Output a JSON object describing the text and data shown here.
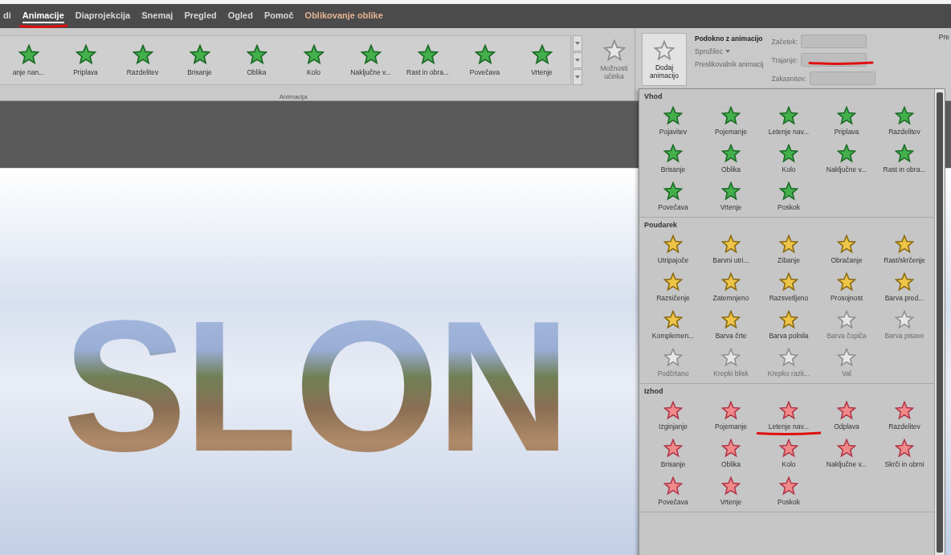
{
  "menu": [
    {
      "label": "di",
      "selected": false,
      "kind": "normal",
      "marked": false
    },
    {
      "label": "Animacije",
      "selected": true,
      "kind": "normal",
      "marked": true
    },
    {
      "label": "Diaprojekcija",
      "selected": false,
      "kind": "normal",
      "marked": false
    },
    {
      "label": "Snemaj",
      "selected": false,
      "kind": "normal",
      "marked": false
    },
    {
      "label": "Pregled",
      "selected": false,
      "kind": "normal",
      "marked": false
    },
    {
      "label": "Ogled",
      "selected": false,
      "kind": "normal",
      "marked": false
    },
    {
      "label": "Pomoč",
      "selected": false,
      "kind": "normal",
      "marked": false
    },
    {
      "label": "Oblikovanje oblike",
      "selected": false,
      "kind": "contextual",
      "marked": false
    }
  ],
  "ribbon": {
    "gallery": {
      "group_label": "Animacija",
      "items": [
        {
          "label": "anje nan..."
        },
        {
          "label": "Priplava"
        },
        {
          "label": "Razdelitev"
        },
        {
          "label": "Brisanje"
        },
        {
          "label": "Oblika"
        },
        {
          "label": "Kolo"
        },
        {
          "label": "Naključne v..."
        },
        {
          "label": "Rast in obra..."
        },
        {
          "label": "Povečava"
        },
        {
          "label": "Vrtenje"
        }
      ]
    },
    "effect_options": {
      "label": "Možnosti učinka",
      "disabled": true
    },
    "add_animation": {
      "label": "Dodaj animacijo"
    },
    "advanced": [
      {
        "label": "Podokno z animacijo",
        "disabled": false
      },
      {
        "label": "Sprožilec",
        "disabled": true
      },
      {
        "label": "Preslikovalnik animacij",
        "disabled": true
      }
    ],
    "timing": [
      {
        "label": "Začetek:",
        "disabled": true,
        "marked": false
      },
      {
        "label": "Trajanje:",
        "disabled": true,
        "marked": true
      },
      {
        "label": "Zakasnitev:",
        "disabled": true,
        "marked": false
      }
    ],
    "next_group_label": "Pre"
  },
  "slide": {
    "title": "SLON"
  },
  "panel": {
    "sections": [
      {
        "title": "Vhod",
        "kind": "entrance",
        "items": [
          {
            "label": "Pojavitev",
            "disabled": false,
            "marked": false
          },
          {
            "label": "Pojemanje",
            "disabled": false,
            "marked": false
          },
          {
            "label": "Letenje nav...",
            "disabled": false,
            "marked": false
          },
          {
            "label": "Priplava",
            "disabled": false,
            "marked": false
          },
          {
            "label": "Razdelitev",
            "disabled": false,
            "marked": false
          },
          {
            "label": "Brisanje",
            "disabled": false,
            "marked": false
          },
          {
            "label": "Oblika",
            "disabled": false,
            "marked": false
          },
          {
            "label": "Kolo",
            "disabled": false,
            "marked": false
          },
          {
            "label": "Naključne v...",
            "disabled": false,
            "marked": false
          },
          {
            "label": "Rast in obra...",
            "disabled": false,
            "marked": false
          },
          {
            "label": "Povečava",
            "disabled": false,
            "marked": false
          },
          {
            "label": "Vrtenje",
            "disabled": false,
            "marked": false
          },
          {
            "label": "Poskok",
            "disabled": false,
            "marked": false
          }
        ]
      },
      {
        "title": "Poudarek",
        "kind": "emphasis",
        "items": [
          {
            "label": "Utripajoče",
            "disabled": false,
            "marked": false
          },
          {
            "label": "Barvni utri...",
            "disabled": false,
            "marked": false
          },
          {
            "label": "Zibanje",
            "disabled": false,
            "marked": false
          },
          {
            "label": "Obračanje",
            "disabled": false,
            "marked": false
          },
          {
            "label": "Rast/skrčenje",
            "disabled": false,
            "marked": false
          },
          {
            "label": "Razsičenje",
            "disabled": false,
            "marked": false
          },
          {
            "label": "Zatemnjeno",
            "disabled": false,
            "marked": false
          },
          {
            "label": "Razsvetljeno",
            "disabled": false,
            "marked": false
          },
          {
            "label": "Prosojnost",
            "disabled": false,
            "marked": false
          },
          {
            "label": "Barva pred...",
            "disabled": false,
            "marked": false
          },
          {
            "label": "Komplemen...",
            "disabled": false,
            "marked": false
          },
          {
            "label": "Barva črte",
            "disabled": false,
            "marked": false
          },
          {
            "label": "Barva polnila",
            "disabled": false,
            "marked": false
          },
          {
            "label": "Barva čopiča",
            "disabled": true,
            "marked": false
          },
          {
            "label": "Barva pisave",
            "disabled": true,
            "marked": false
          },
          {
            "label": "Podčrtano",
            "disabled": true,
            "marked": false
          },
          {
            "label": "Krepki blisk",
            "disabled": true,
            "marked": false
          },
          {
            "label": "Krepko razk...",
            "disabled": true,
            "marked": false
          },
          {
            "label": "Val",
            "disabled": true,
            "marked": false
          }
        ]
      },
      {
        "title": "Izhod",
        "kind": "exit",
        "items": [
          {
            "label": "Izginjanje",
            "disabled": false,
            "marked": false
          },
          {
            "label": "Pojemanje",
            "disabled": false,
            "marked": false
          },
          {
            "label": "Letenje nav...",
            "disabled": false,
            "marked": true
          },
          {
            "label": "Odplava",
            "disabled": false,
            "marked": false
          },
          {
            "label": "Razdelitev",
            "disabled": false,
            "marked": false
          },
          {
            "label": "Brisanje",
            "disabled": false,
            "marked": false
          },
          {
            "label": "Oblika",
            "disabled": false,
            "marked": false
          },
          {
            "label": "Kolo",
            "disabled": false,
            "marked": false
          },
          {
            "label": "Naključne v...",
            "disabled": false,
            "marked": false
          },
          {
            "label": "Skrči in obrni",
            "disabled": false,
            "marked": false
          },
          {
            "label": "Povečava",
            "disabled": false,
            "marked": false
          },
          {
            "label": "Vrtenje",
            "disabled": false,
            "marked": false
          },
          {
            "label": "Poskok",
            "disabled": false,
            "marked": false
          }
        ]
      }
    ]
  }
}
